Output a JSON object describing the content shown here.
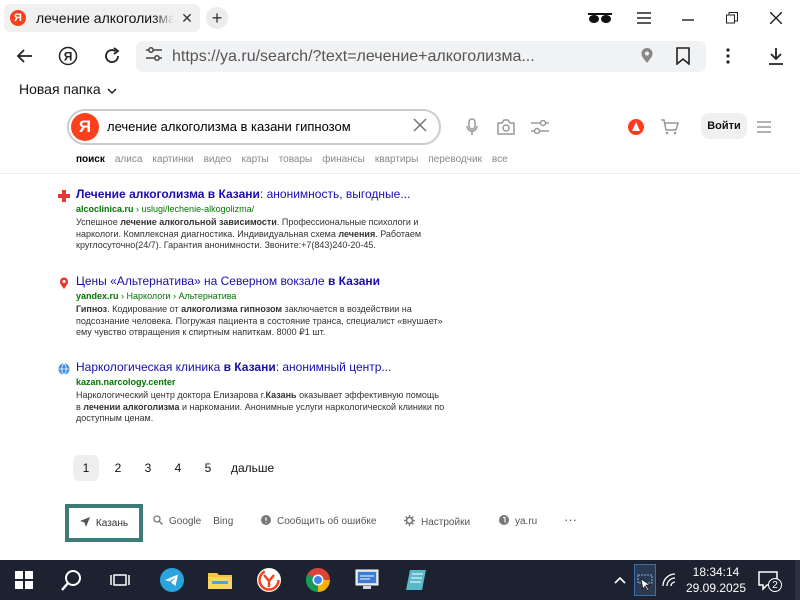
{
  "browser": {
    "tab_title": "лечение алкоголизма в казани гипнозом",
    "tab_close": "✕",
    "new_tab": "+",
    "address": "https://ya.ru/search/?text=лечение+алкоголизма...",
    "bookmark_folder": "Новая папка"
  },
  "yandex": {
    "logo": "Я",
    "query": "лечение алкоголизма в казани гипнозом",
    "login": "Войти",
    "tabs": [
      "поиск",
      "алиса",
      "картинки",
      "видео",
      "карты",
      "товары",
      "финансы",
      "квартиры",
      "переводчик",
      "все"
    ]
  },
  "results": [
    {
      "title_parts": [
        "Лечение алкоголизма в Казани",
        ": анонимность, выгодные..."
      ],
      "domain": "alcoclinica.ru",
      "path": " › uslugi/lechenie-alkogolizma/",
      "snippet": [
        {
          "t": "Успешное ",
          "b": false
        },
        {
          "t": "лечение алкогольной зависимости",
          "b": true
        },
        {
          "t": ". Профессиональные психологи и наркологи. Комплексная диагностика. Индивидуальная схема ",
          "b": false
        },
        {
          "t": "лечения",
          "b": true
        },
        {
          "t": ". Работаем круглосуточно(24/7). Гарантия анонимности. Звоните:+7(843)240-20-45.",
          "b": false
        }
      ]
    },
    {
      "title_parts": [
        "Цены «Альтернатива» на Северном вокзале ",
        "в Казани"
      ],
      "domain": "yandex.ru",
      "path": " › Наркологи › Альтернатива",
      "snippet": [
        {
          "t": "Гипноз",
          "b": true
        },
        {
          "t": ". Кодирование от ",
          "b": false
        },
        {
          "t": "алкоголизма гипнозом",
          "b": true
        },
        {
          "t": " заключается в воздействии на подсознание человека. Погружая пациента в состояние транса, специалист «внушает» ему чувство отвращения к спиртным напиткам. 8000 ₽1 шт.",
          "b": false
        }
      ]
    },
    {
      "title_parts": [
        "Наркологическая клиника ",
        "в Казани",
        ": анонимный центр..."
      ],
      "domain": "kazan.narcology.center",
      "path": "",
      "snippet": [
        {
          "t": "Наркологический центр доктора Елизарова г.",
          "b": false
        },
        {
          "t": "Казань",
          "b": true
        },
        {
          "t": " оказывает эффективную помощь в ",
          "b": false
        },
        {
          "t": "лечении алкоголизма",
          "b": true
        },
        {
          "t": " и наркомании. Анонимные услуги наркологической клиники по доступным ценам.",
          "b": false
        }
      ]
    }
  ],
  "pagination": {
    "pages": [
      "1",
      "2",
      "3",
      "4",
      "5"
    ],
    "next": "дальше"
  },
  "footer": {
    "city": "Казань",
    "google": "Google",
    "bing": "Bing",
    "report": "Сообщить об ошибке",
    "settings": "Настройки",
    "yaru": "ya.ru",
    "more": "···"
  },
  "taskbar": {
    "time": "18:34:14",
    "date": "29.09.2025",
    "notifications": "2"
  },
  "colors": {
    "yandex_red": "#fc3f1d",
    "link": "#1a0dab",
    "url_green": "#007700",
    "taskbar": "#1d2230",
    "city_border": "#3e7a78"
  }
}
